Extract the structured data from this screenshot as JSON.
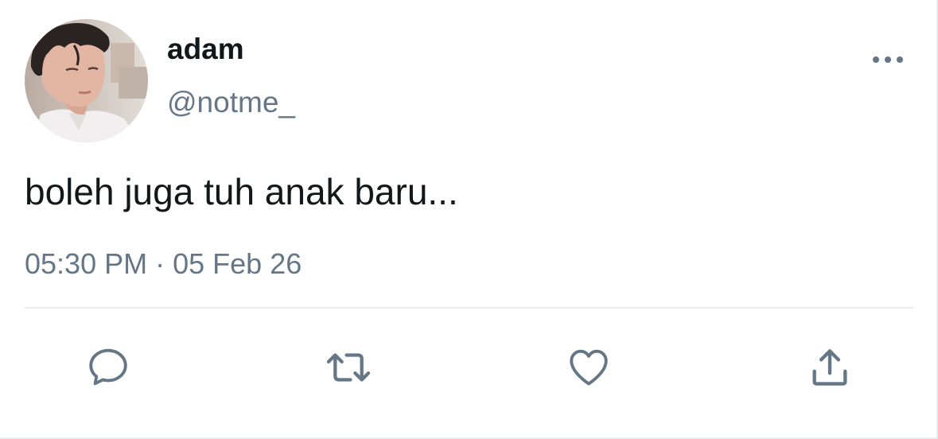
{
  "user": {
    "display_name": "adam",
    "handle": "@notme_",
    "avatar_icon": "profile-photo"
  },
  "tweet": {
    "text": "boleh juga tuh anak baru...",
    "time": "05:30 PM",
    "separator": "·",
    "date": "05 Feb 26"
  },
  "actions": {
    "reply_icon": "comment-bubble-icon",
    "retweet_icon": "retweet-icon",
    "like_icon": "heart-icon",
    "share_icon": "share-upload-icon",
    "more_icon": "more-dots-icon"
  },
  "colors": {
    "text_primary": "#14171a",
    "text_secondary": "#657786",
    "icon": "#657786",
    "divider": "#e6ecf0"
  }
}
